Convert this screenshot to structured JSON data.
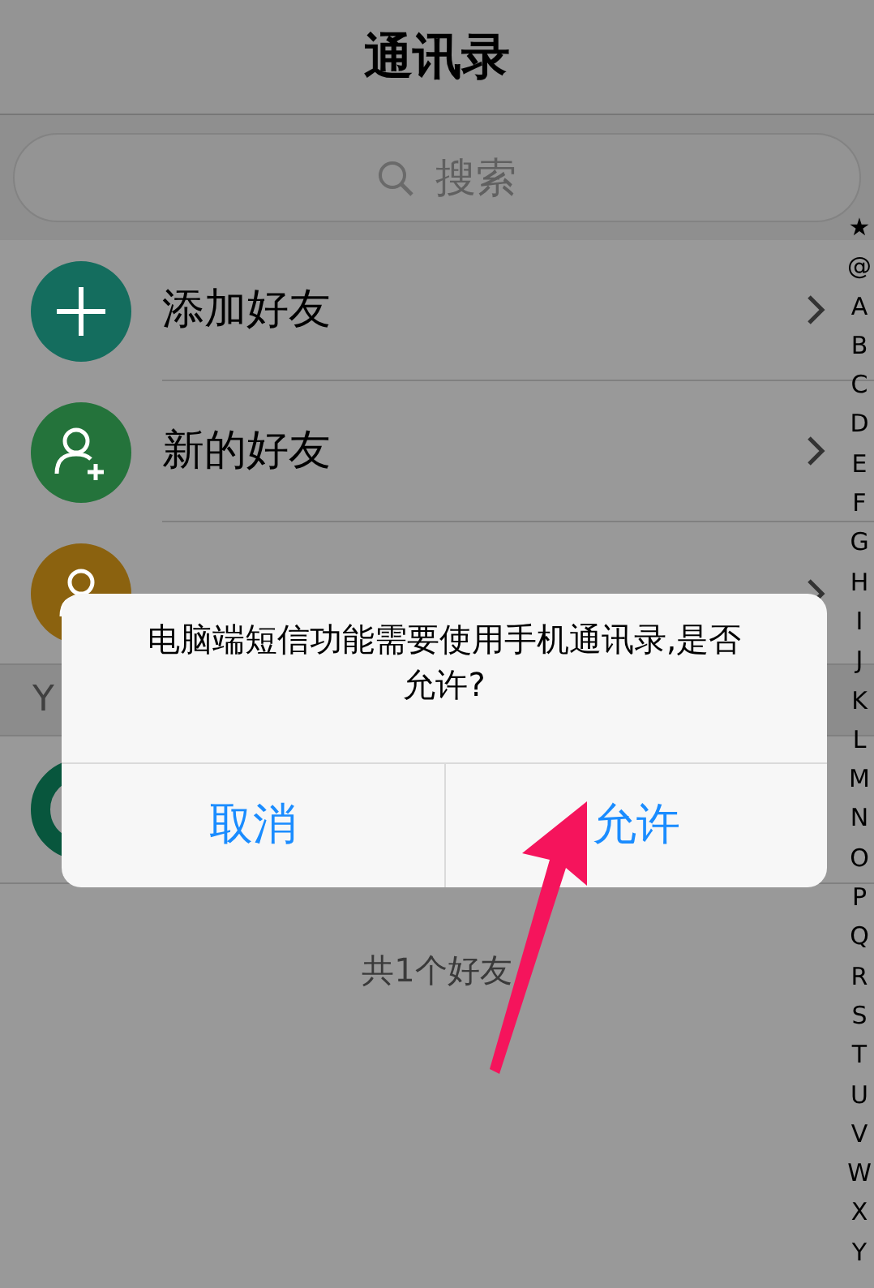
{
  "title": "通讯录",
  "search": {
    "placeholder": "搜索"
  },
  "menu_items": [
    {
      "kind": "add",
      "label": "添加好友",
      "color": "#146d5e"
    },
    {
      "kind": "new_friend",
      "label": "新的好友",
      "color": "#24733b"
    },
    {
      "kind": "official",
      "color": "#8b620f"
    }
  ],
  "sections": [
    {
      "letter": "Y",
      "contacts": [
        {
          "color": "#08563d"
        }
      ]
    }
  ],
  "footer": "共1个好友",
  "index": [
    "★",
    "@",
    "A",
    "B",
    "C",
    "D",
    "E",
    "F",
    "G",
    "H",
    "I",
    "J",
    "K",
    "L",
    "M",
    "N",
    "O",
    "P",
    "Q",
    "R",
    "S",
    "T",
    "U",
    "V",
    "W",
    "X",
    "Y"
  ],
  "dialog": {
    "message": "电脑端短信功能需要使用手机通讯录,是否允许?",
    "buttons": [
      {
        "label": "取消"
      },
      {
        "label": "允许"
      }
    ]
  }
}
